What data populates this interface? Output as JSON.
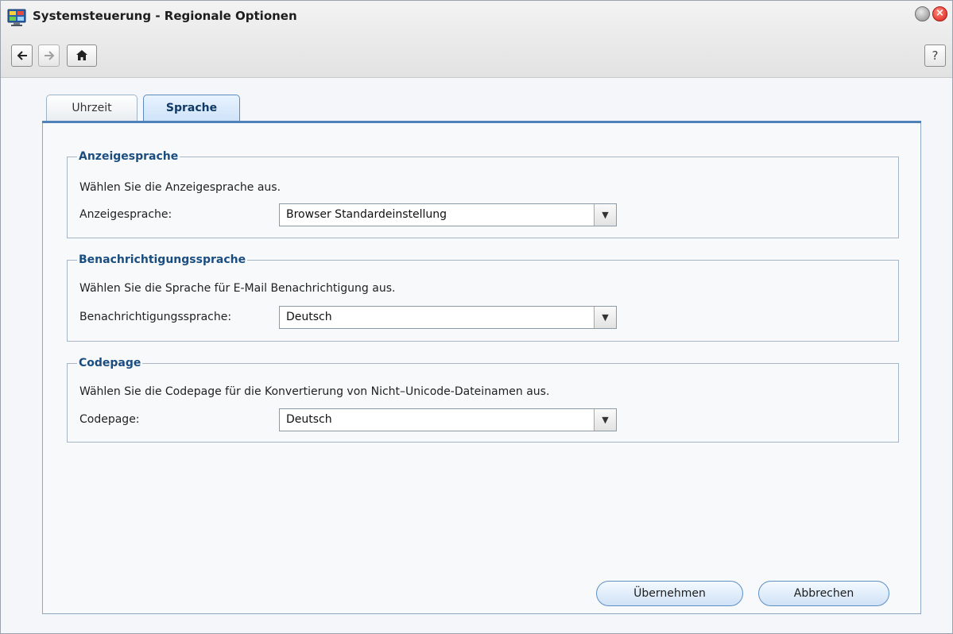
{
  "window": {
    "title": "Systemsteuerung - Regionale Optionen",
    "app_icon": "control-panel-icon"
  },
  "toolbar": {
    "back_icon": "arrow-left-icon",
    "forward_icon": "arrow-right-icon",
    "home_icon": "home-icon",
    "help_label": "?"
  },
  "tabs": [
    {
      "label": "Uhrzeit",
      "active": false
    },
    {
      "label": "Sprache",
      "active": true
    }
  ],
  "sections": [
    {
      "legend": "Anzeigesprache",
      "description": "Wählen Sie die Anzeigesprache aus.",
      "field_label": "Anzeigesprache:",
      "selected_value": "Browser Standardeinstellung"
    },
    {
      "legend": "Benachrichtigungssprache",
      "description": "Wählen Sie die Sprache für E-Mail Benachrichtigung aus.",
      "field_label": "Benachrichtigungssprache:",
      "selected_value": "Deutsch"
    },
    {
      "legend": "Codepage",
      "description": "Wählen Sie die Codepage für die Konvertierung von Nicht–Unicode-Dateinamen aus.",
      "field_label": "Codepage:",
      "selected_value": "Deutsch"
    }
  ],
  "buttons": {
    "apply_label": "Übernehmen",
    "cancel_label": "Abbrechen"
  },
  "colors": {
    "accent": "#4f82b8",
    "legend_text": "#1a4d80",
    "close_button": "#d8201a"
  }
}
